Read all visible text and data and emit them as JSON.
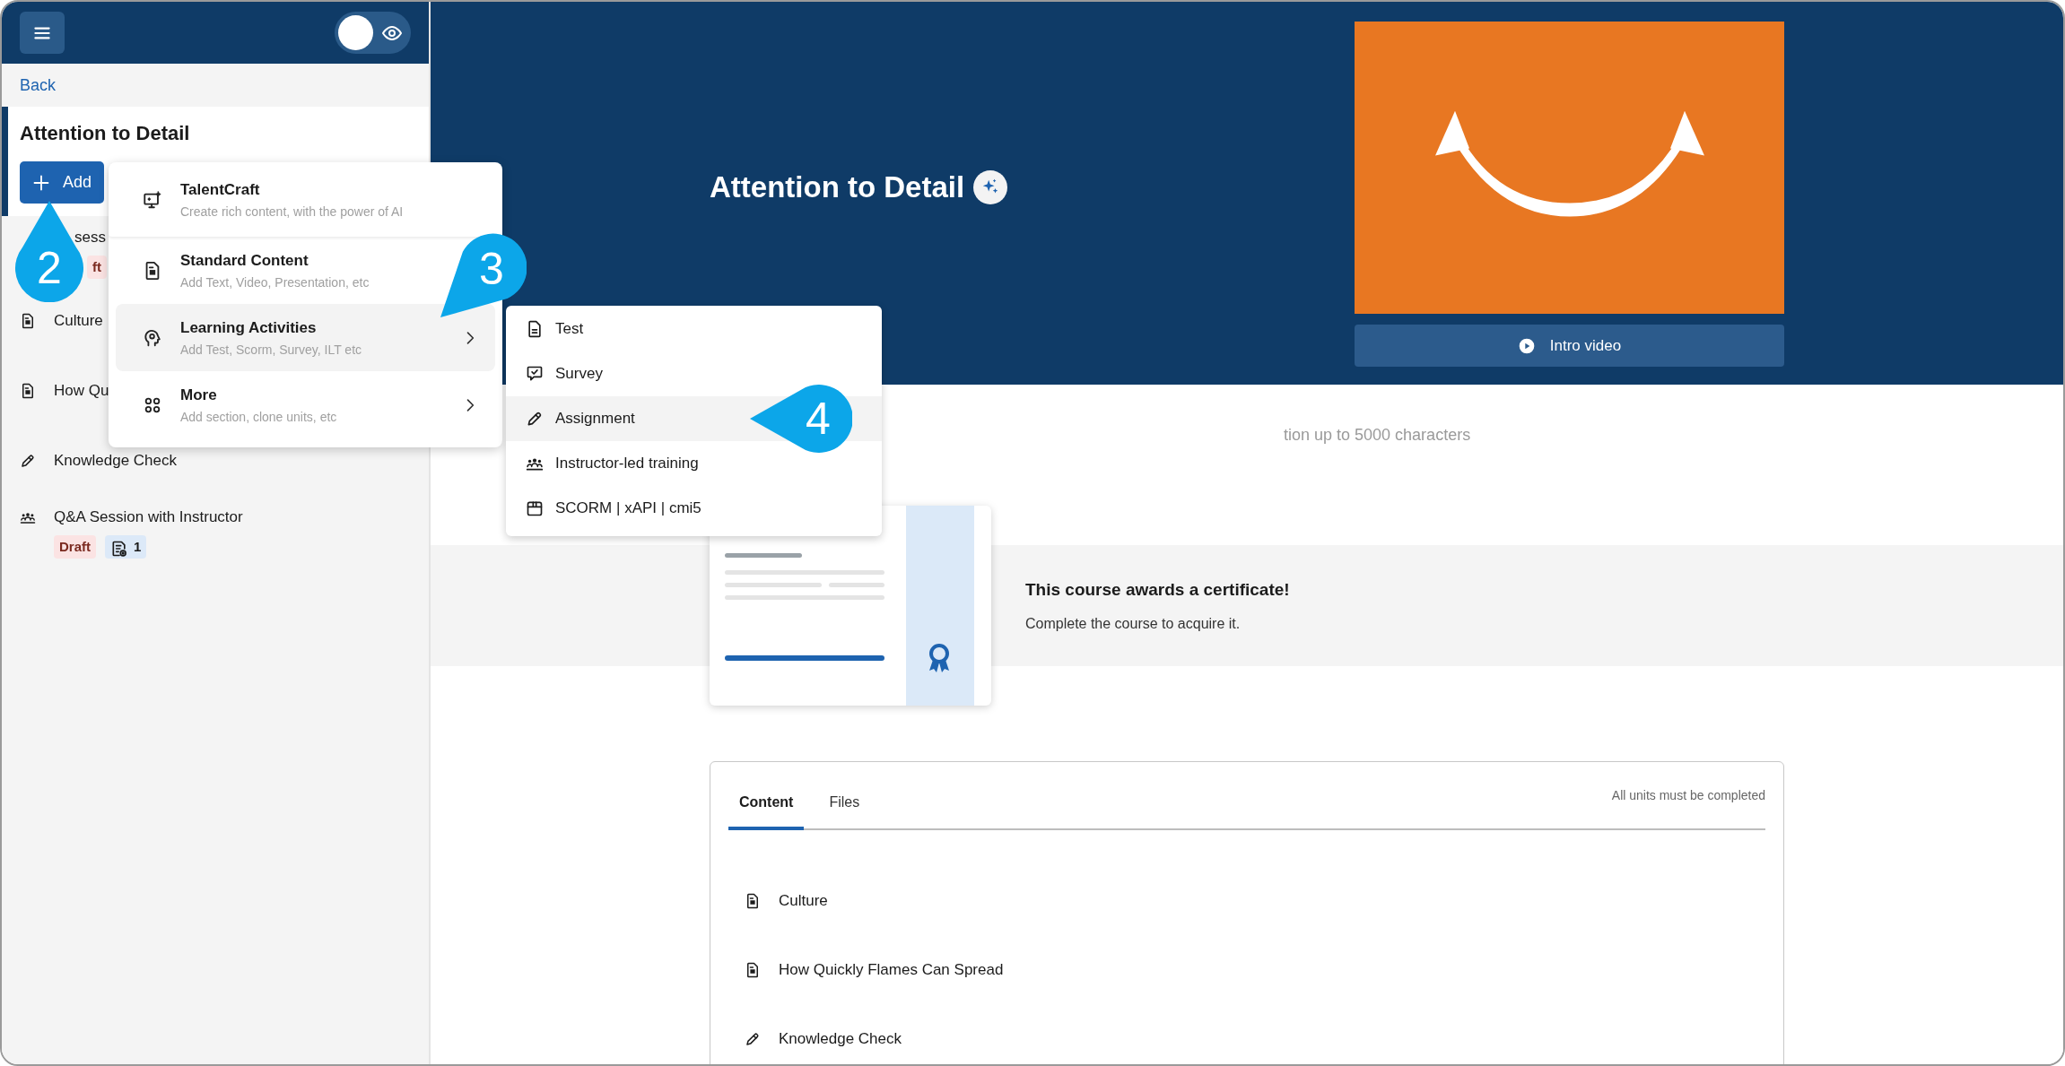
{
  "sidebar": {
    "preview_toggle": {
      "on": false
    },
    "back_link": "Back",
    "course_title": "Attention to Detail",
    "add_button": "Add",
    "items": [
      {
        "kind": "covered",
        "title": "sess",
        "badges": [
          {
            "kind": "status",
            "label": "ft"
          }
        ]
      },
      {
        "kind": "document",
        "title": "Culture"
      },
      {
        "kind": "document",
        "title": "How Qu"
      },
      {
        "kind": "assignment",
        "title": "Knowledge Check"
      },
      {
        "kind": "ilt",
        "title": "Q&A Session with Instructor",
        "badges": [
          {
            "kind": "status",
            "label": "Draft"
          },
          {
            "kind": "files",
            "label": "1"
          }
        ]
      }
    ]
  },
  "add_menu": {
    "items": [
      {
        "title": "TalentCraft",
        "subtitle": "Create rich content, with the power of AI",
        "has_submenu": false,
        "selected": false
      },
      {
        "title": "Standard Content",
        "subtitle": "Add Text, Video, Presentation, etc",
        "has_submenu": false,
        "selected": false
      },
      {
        "title": "Learning Activities",
        "subtitle": "Add Test, Scorm, Survey, ILT etc",
        "has_submenu": true,
        "selected": true
      },
      {
        "title": "More",
        "subtitle": "Add section, clone units, etc",
        "has_submenu": true,
        "selected": false
      }
    ]
  },
  "submenu": {
    "items": [
      {
        "label": "Test",
        "selected": false
      },
      {
        "label": "Survey",
        "selected": false
      },
      {
        "label": "Assignment",
        "selected": true
      },
      {
        "label": "Instructor-led training",
        "selected": false
      },
      {
        "label": "SCORM | xAPI | cmi5",
        "selected": false
      }
    ]
  },
  "header": {
    "title": "Attention to Detail",
    "intro_video_button": "Intro video"
  },
  "description": "tion up to 5000 characters",
  "certificate": {
    "title": "This course awards a certificate!",
    "text": "Complete the course to acquire it."
  },
  "content": {
    "tabs": [
      {
        "label": "Content",
        "selected": true
      },
      {
        "label": "Files",
        "selected": false
      }
    ],
    "completion_rule": "All units must be completed",
    "units": [
      {
        "kind": "document",
        "title": "Culture"
      },
      {
        "kind": "document",
        "title": "How Quickly Flames Can Spread"
      },
      {
        "kind": "assignment",
        "title": "Knowledge Check"
      }
    ]
  },
  "callouts": [
    {
      "number": "2"
    },
    {
      "number": "3"
    },
    {
      "number": "4"
    }
  ]
}
